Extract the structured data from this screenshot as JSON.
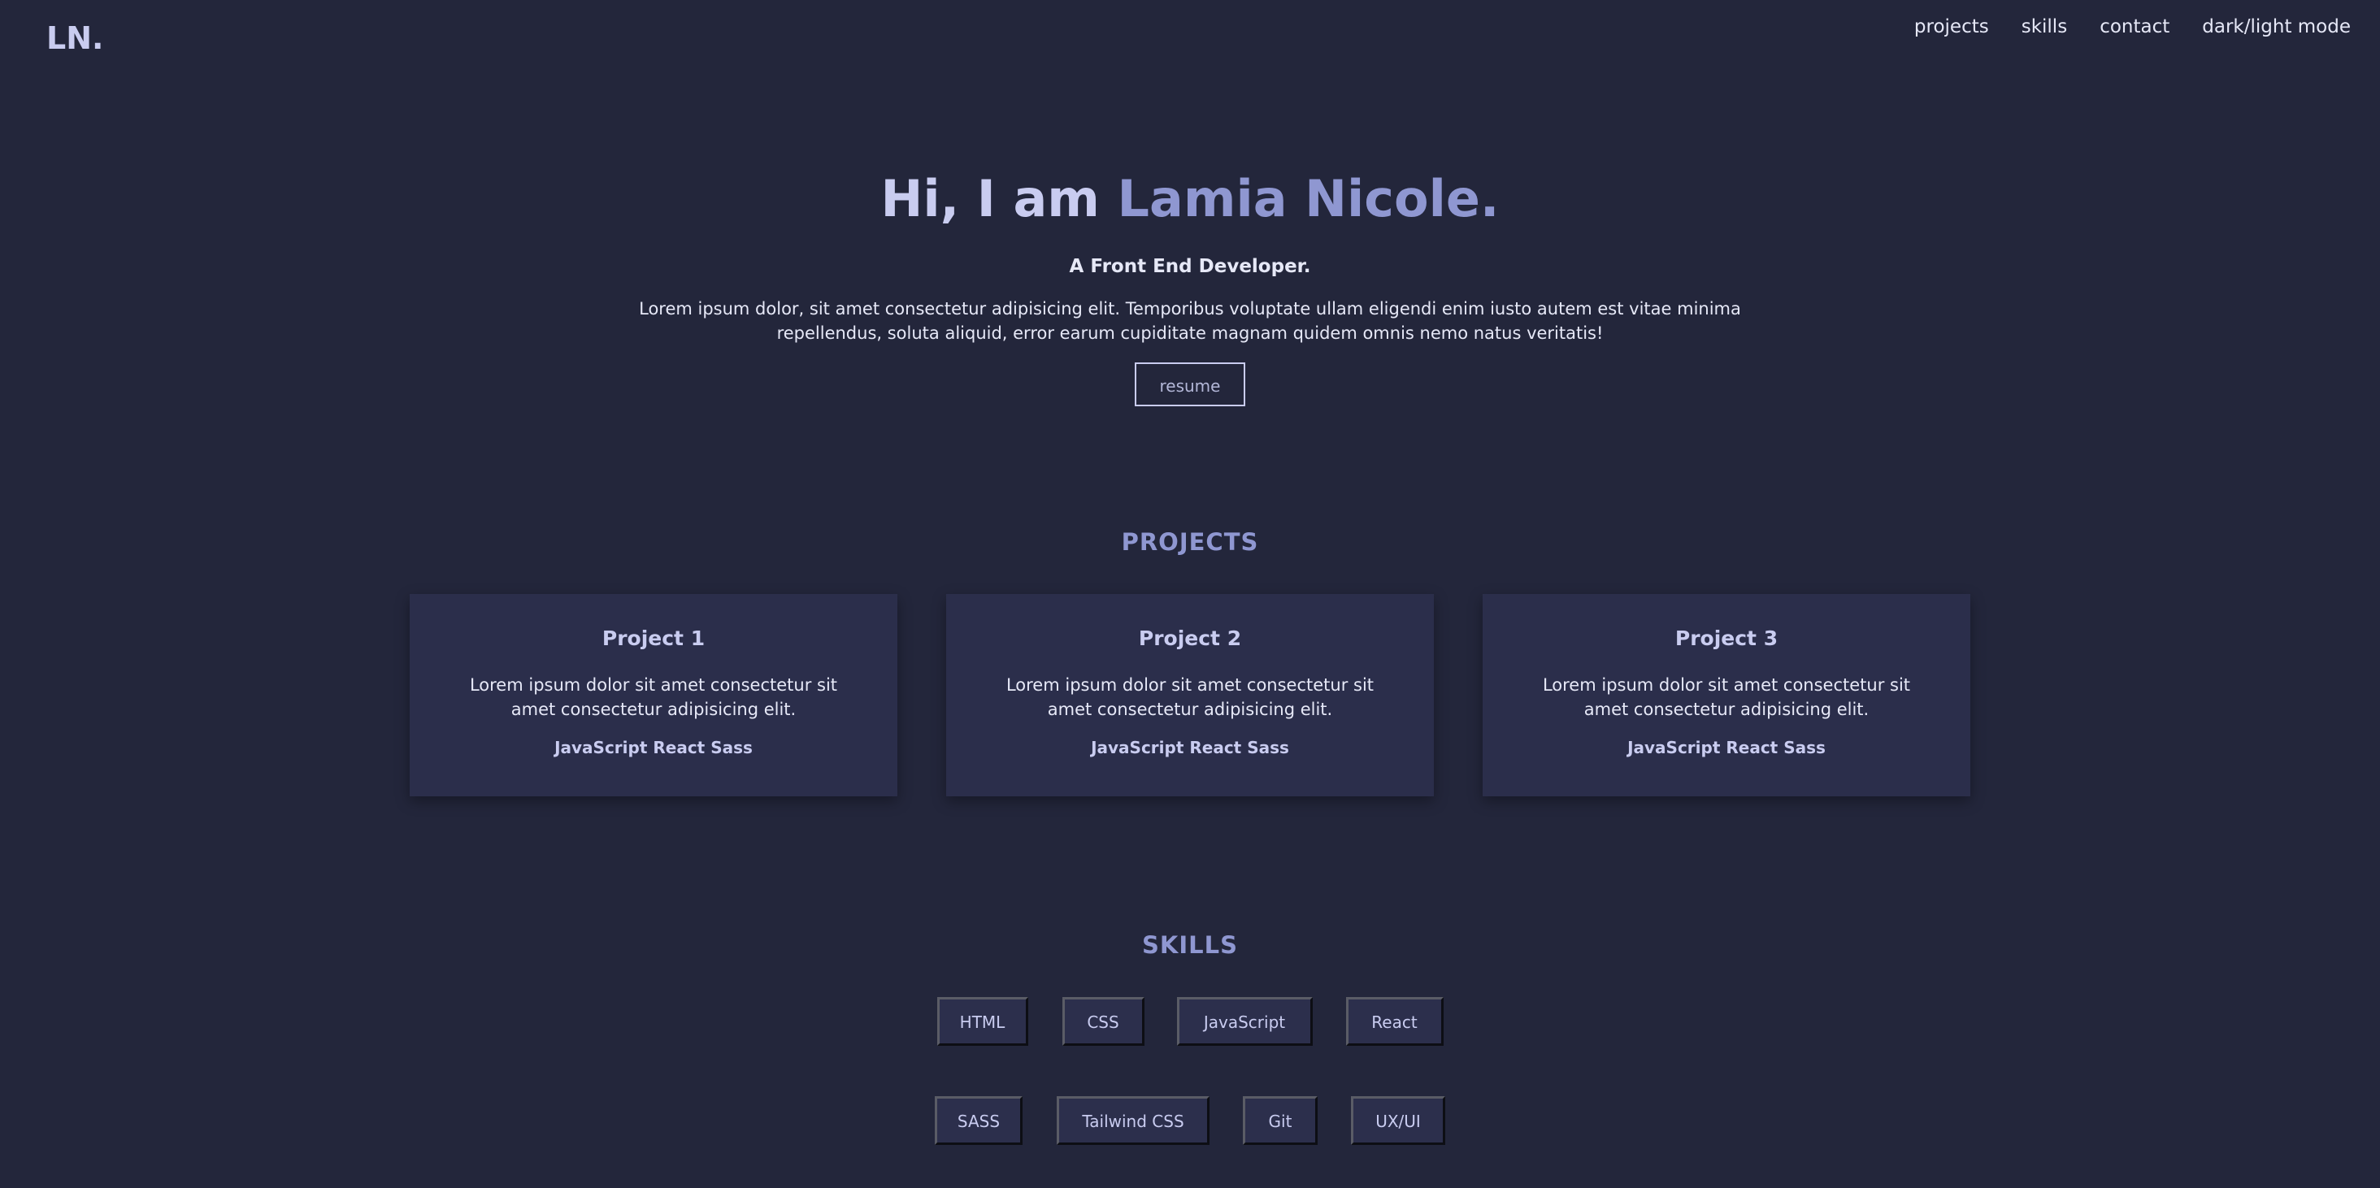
{
  "header": {
    "logo": "LN.",
    "nav": [
      "projects",
      "skills",
      "contact",
      "dark/light mode"
    ]
  },
  "hero": {
    "title_prefix": "Hi, I am ",
    "title_name": "Lamia Nicole.",
    "subtitle": "A Front End Developer.",
    "text": "Lorem ipsum dolor, sit amet consectetur adipisicing elit. Temporibus voluptate ullam eligendi enim iusto autem est vitae minima repellendus, soluta aliquid, error earum cupiditate magnam quidem omnis nemo natus veritatis!",
    "resume_label": "resume"
  },
  "projects": {
    "title": "PROJECTS",
    "items": [
      {
        "title": "Project 1",
        "desc": "Lorem ipsum dolor sit amet consectetur sit amet consectetur adipisicing elit.",
        "tech": "JavaScript React Sass"
      },
      {
        "title": "Project 2",
        "desc": "Lorem ipsum dolor sit amet consectetur sit amet consectetur adipisicing elit.",
        "tech": "JavaScript React Sass"
      },
      {
        "title": "Project 3",
        "desc": "Lorem ipsum dolor sit amet consectetur sit amet consectetur adipisicing elit.",
        "tech": "JavaScript React Sass"
      }
    ]
  },
  "skills": {
    "title": "SKILLS",
    "row1": [
      "HTML",
      "CSS",
      "JavaScript",
      "React"
    ],
    "row2": [
      "SASS",
      "Tailwind CSS",
      "Git",
      "UX/UI"
    ]
  },
  "colors": {
    "background": "#23263b",
    "card": "#2b2e4b",
    "accent": "#8f97d1",
    "heading": "#c9ccf0",
    "text": "#e6e8f7"
  }
}
